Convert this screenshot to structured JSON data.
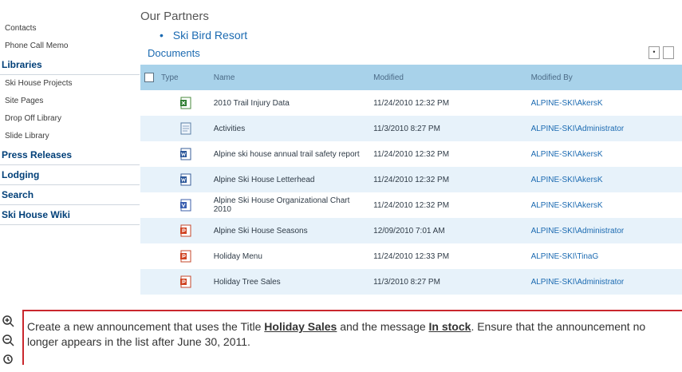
{
  "nav": {
    "top_items": [
      "Contacts",
      "Phone Call Memo"
    ],
    "libraries_head": "Libraries",
    "library_items": [
      "Ski House Projects",
      "Site Pages",
      "Drop Off Library",
      "Slide Library"
    ],
    "heads": [
      "Press Releases",
      "Lodging",
      "Search",
      "Ski House Wiki"
    ]
  },
  "partners": {
    "title": "Our Partners",
    "link": "Ski Bird Resort",
    "bullet": "•"
  },
  "documents": {
    "title": "Documents",
    "columns": {
      "type": "Type",
      "name": "Name",
      "modified": "Modified",
      "modified_by": "Modified By"
    },
    "header_button": "•",
    "rows": [
      {
        "icon": "excel-icon",
        "name": "2010 Trail Injury Data",
        "modified": "11/24/2010 12:32 PM",
        "modified_by": "ALPINE-SKI\\AkersK"
      },
      {
        "icon": "document-icon",
        "name": "Activities",
        "modified": "11/3/2010 8:27 PM",
        "modified_by": "ALPINE-SKI\\Administrator"
      },
      {
        "icon": "word-icon",
        "name": "Alpine ski house annual trail safety report",
        "modified": "11/24/2010 12:32 PM",
        "modified_by": "ALPINE-SKI\\AkersK"
      },
      {
        "icon": "word-icon",
        "name": "Alpine Ski House Letterhead",
        "modified": "11/24/2010 12:32 PM",
        "modified_by": "ALPINE-SKI\\AkersK"
      },
      {
        "icon": "visio-icon",
        "name": "Alpine Ski House Organizational Chart 2010",
        "modified": "11/24/2010 12:32 PM",
        "modified_by": "ALPINE-SKI\\AkersK"
      },
      {
        "icon": "powerpoint-icon",
        "name": "Alpine Ski House Seasons",
        "modified": "12/09/2010 7:01 AM",
        "modified_by": "ALPINE-SKI\\Administrator"
      },
      {
        "icon": "powerpoint-icon",
        "name": "Holiday Menu",
        "modified": "11/24/2010 12:33 PM",
        "modified_by": "ALPINE-SKI\\TinaG"
      },
      {
        "icon": "powerpoint-icon",
        "name": "Holiday Tree Sales",
        "modified": "11/3/2010 8:27 PM",
        "modified_by": "ALPINE-SKI\\Administrator"
      }
    ]
  },
  "task": {
    "prefix": "Create a new announcement that uses the Title ",
    "title_value": "Holiday Sales",
    "middle": " and the message ",
    "message_value": "In stock",
    "suffix": ". Ensure that the announcement no longer appears in the list after June 30, 2011."
  },
  "colors": {
    "header_bg": "#a8d2ea",
    "alt_row": "#e7f2fa",
    "link": "#1b6ab1",
    "task_border": "#c9272d"
  }
}
